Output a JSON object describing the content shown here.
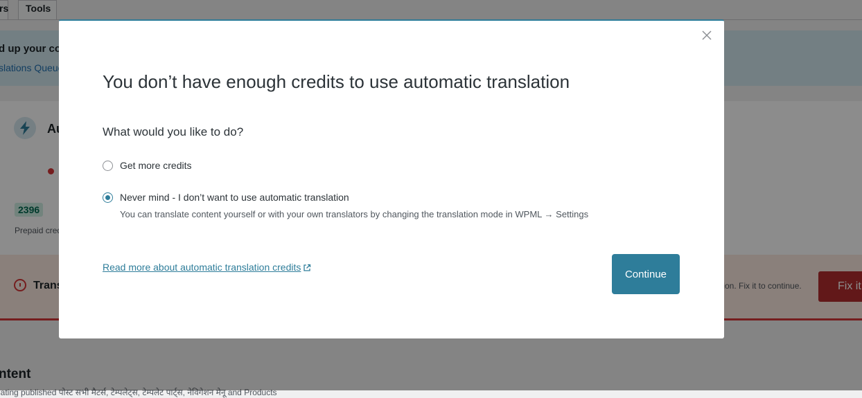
{
  "background": {
    "tabs": {
      "prev_tab_label": "rs",
      "tools_label": "Tools"
    },
    "info_panel": {
      "title": "d up your co",
      "link": "slations Queue"
    },
    "card": {
      "title": "Au",
      "credits_value": "2396",
      "credits_caption": "Prepaid cred"
    },
    "error_bar": {
      "title": "Trans",
      "message": "tion. Fix it to continue.",
      "fix_button": "Fix it"
    },
    "content": {
      "title": "ntent",
      "description": "lating published पोस्ट सभी मैटर्स, टेम्पलेट्स, टेम्पलेट पार्ट्स, नेविगेशन मेनू and Products"
    }
  },
  "modal": {
    "title": "You don’t have enough credits to use automatic translation",
    "question": "What would you like to do?",
    "options": [
      {
        "label": "Get more credits",
        "checked": false
      },
      {
        "label": "Never mind - I don’t want to use automatic translation",
        "checked": true
      }
    ],
    "option_description": "You can translate content yourself or with your own translators by changing the translation mode in WPML → Settings",
    "read_more_link": "Read more about automatic translation credits",
    "continue_button": "Continue",
    "accent_color": "#2e7d9a"
  }
}
